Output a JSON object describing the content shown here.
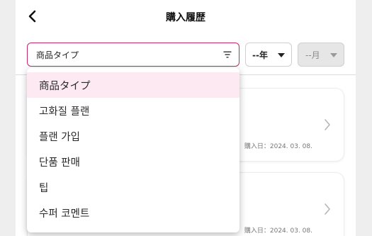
{
  "header": {
    "title": "購入履歴",
    "back_icon": "chevron-left-icon"
  },
  "filters": {
    "type_select": {
      "value": "商品タイプ",
      "icon": "filter-icon"
    },
    "year_select": {
      "value": "--年",
      "icon": "caret-down-icon"
    },
    "month_select": {
      "value": "--月",
      "icon": "caret-down-icon",
      "disabled": true
    }
  },
  "cards": [
    {
      "date_text": "購入日：2024. 03. 08."
    },
    {
      "date_text": "購入日：2024. 03. 08."
    }
  ],
  "dropdown": {
    "options": [
      "商品タイプ",
      "고화질 플랜",
      "플랜 가입",
      "단품 판매",
      "팁",
      "수퍼 코멘트"
    ],
    "selected_index": 0
  },
  "colors": {
    "accent": "#c2276e",
    "selected_bg": "#fde9f2",
    "background": "#eeeeee",
    "panel": "#ffffff"
  }
}
